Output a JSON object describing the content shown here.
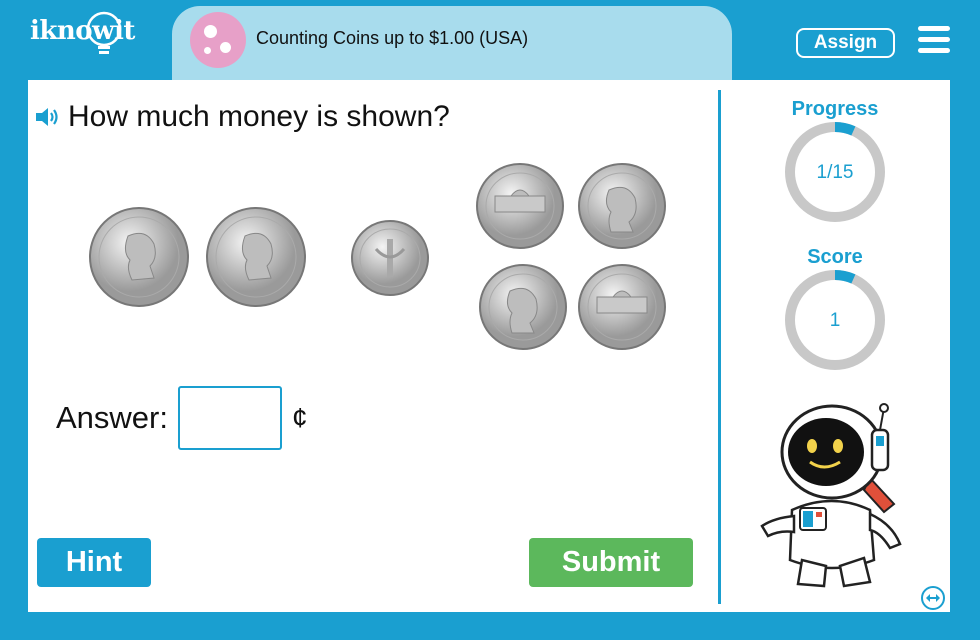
{
  "header": {
    "logo": "iknowit",
    "topic_title": "Counting Coins up to $1.00 (USA)",
    "assign_label": "Assign"
  },
  "question": {
    "text": "How much money is shown?"
  },
  "coins": [
    "quarter",
    "quarter",
    "dime",
    "nickel",
    "nickel",
    "nickel",
    "nickel"
  ],
  "answer": {
    "label": "Answer:",
    "value": "",
    "unit": "¢"
  },
  "buttons": {
    "hint": "Hint",
    "submit": "Submit"
  },
  "progress": {
    "title": "Progress",
    "value": "1/15",
    "fraction": 0.067
  },
  "score": {
    "title": "Score",
    "value": "1",
    "fraction": 0.067
  },
  "colors": {
    "brand": "#1a9fd0",
    "topic_pill": "#a8dced",
    "topic_icon": "#e7a0c8",
    "submit": "#5cb85c",
    "ring_track": "#c8c8c8"
  }
}
